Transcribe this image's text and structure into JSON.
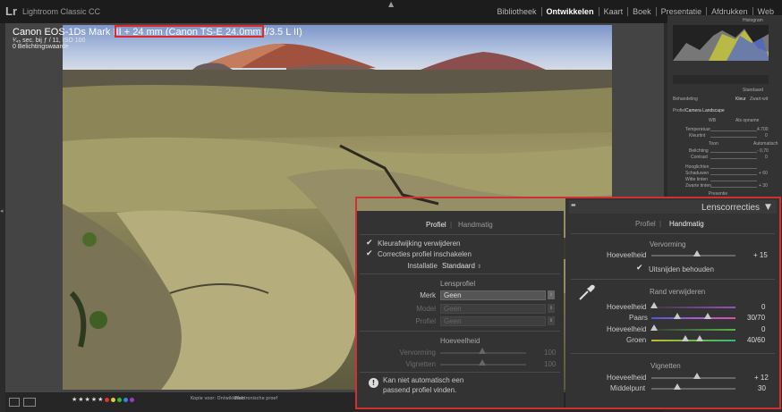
{
  "app": {
    "logo": "Lr",
    "name": "Lightroom Classic CC",
    "collapse_arrow": "▲"
  },
  "modules": [
    {
      "label": "Bibliotheek",
      "active": false
    },
    {
      "label": "Ontwikkelen",
      "active": true
    },
    {
      "label": "Kaart",
      "active": false
    },
    {
      "label": "Boek",
      "active": false
    },
    {
      "label": "Presentatie",
      "active": false
    },
    {
      "label": "Afdrukken",
      "active": false
    },
    {
      "label": "Web",
      "active": false
    }
  ],
  "photo_info": {
    "camera": "Canon EOS-1Ds Mark III",
    "separator": "+",
    "lens": "24 mm (Canon TS-E 24.0mm f/3.5 L II)",
    "exposure": "¹⁄₄₅ sec. bij ƒ / 11, ISO 100",
    "exposure_value": "0 Belichtingswaarde"
  },
  "toolbar": {
    "stars": "★★★★★",
    "before_after": "Kopie voor: Ontwikkelen",
    "soft_proof": "Elektronische proef"
  },
  "right_panel": {
    "histogram": "Histogram",
    "standard": "Standaard",
    "treatment": "Behandeling",
    "color": "Kleur",
    "bw": "Zwart-wit",
    "profile_label": "Profiel",
    "profile_value": "Camera Landscape",
    "wb": "WB",
    "as_shot": "Als opname",
    "temp": "Temperatuur",
    "tint": "Kleurtint",
    "tone": "Toon",
    "auto": "Automatisch",
    "exposure": "Belichting",
    "contrast": "Contrast",
    "highlights": "Hooglichten",
    "shadows": "Schaduwen",
    "whites": "Witte tinten",
    "blacks": "Zwarte tinten",
    "presence": "Presentie",
    "values": [
      "4.700",
      "0",
      "- 0,70",
      "0",
      "+ 60",
      "+ 30"
    ]
  },
  "lens_left": {
    "tabs": {
      "profile": "Profiel",
      "manual": "Handmatig"
    },
    "chromatic": "Kleurafwijking verwijderen",
    "enable_profile": "Correcties profiel inschakelen",
    "setup_label": "Installatie",
    "setup_value": "Standaard",
    "lens_profile_title": "Lensprofiel",
    "make_label": "Merk",
    "make_value": "Geen",
    "model_label": "Model",
    "model_value": "Geen",
    "profile_label": "Profiel",
    "profile_value": "Geen",
    "amount_title": "Hoeveelheid",
    "distortion_label": "Vervorming",
    "distortion_value": "100",
    "vignetting_label": "Vignetten",
    "vignetting_value": "100",
    "warning_icon": "!",
    "warning_text_1": "Kan niet automatisch een",
    "warning_text_2": "passend profiel vinden."
  },
  "lens_right": {
    "title": "Lenscorrecties",
    "collapse": "▼",
    "tabs": {
      "profile": "Profiel",
      "manual": "Handmatig"
    },
    "distortion_title": "Vervorming",
    "distortion_amount_label": "Hoeveelheid",
    "distortion_amount": "+ 15",
    "constrain_crop": "Uitsnijden behouden",
    "defringe_title": "Rand verwijderen",
    "purple_amount_label": "Hoeveelheid",
    "purple_amount": "0",
    "purple_hue_label": "Paars",
    "purple_hue": "30/70",
    "green_amount_label": "Hoeveelheid",
    "green_amount": "0",
    "green_hue_label": "Groen",
    "green_hue": "40/60",
    "vignetting_title": "Vignetten",
    "vig_amount_label": "Hoeveelheid",
    "vig_amount": "+ 12",
    "midpoint_label": "Middelpunt",
    "midpoint": "30"
  }
}
